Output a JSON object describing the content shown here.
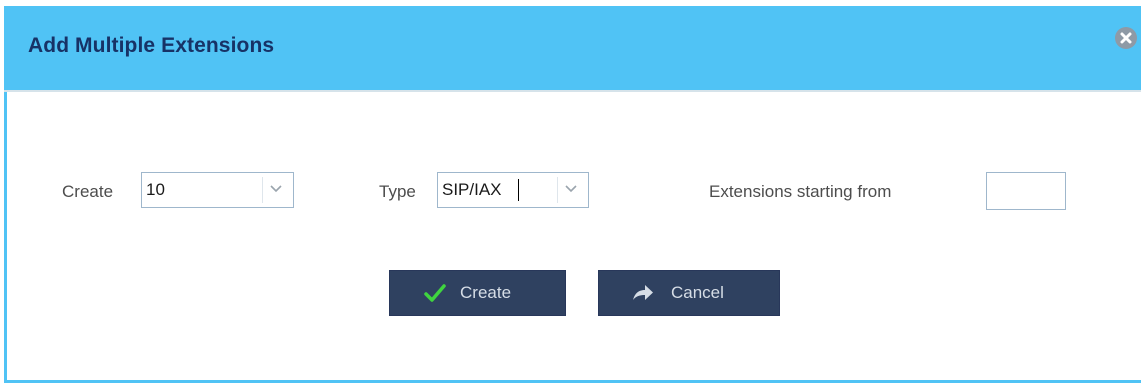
{
  "dialog": {
    "title": "Add Multiple Extensions"
  },
  "form": {
    "create_label": "Create",
    "create_value": "10",
    "type_label": "Type",
    "type_value": "SIP/IAX",
    "start_label": "Extensions starting from",
    "start_value": ""
  },
  "buttons": {
    "create_label": "Create",
    "cancel_label": "Cancel"
  },
  "icons": {
    "close": "close-circle-icon",
    "create": "checkmark-icon",
    "cancel": "share-arrow-icon",
    "dropdown": "chevron-down-icon"
  },
  "colors": {
    "titlebar": "#50c3f5",
    "title_text": "#173266",
    "button_bg": "#2f4160",
    "check_green": "#3fd43f"
  }
}
